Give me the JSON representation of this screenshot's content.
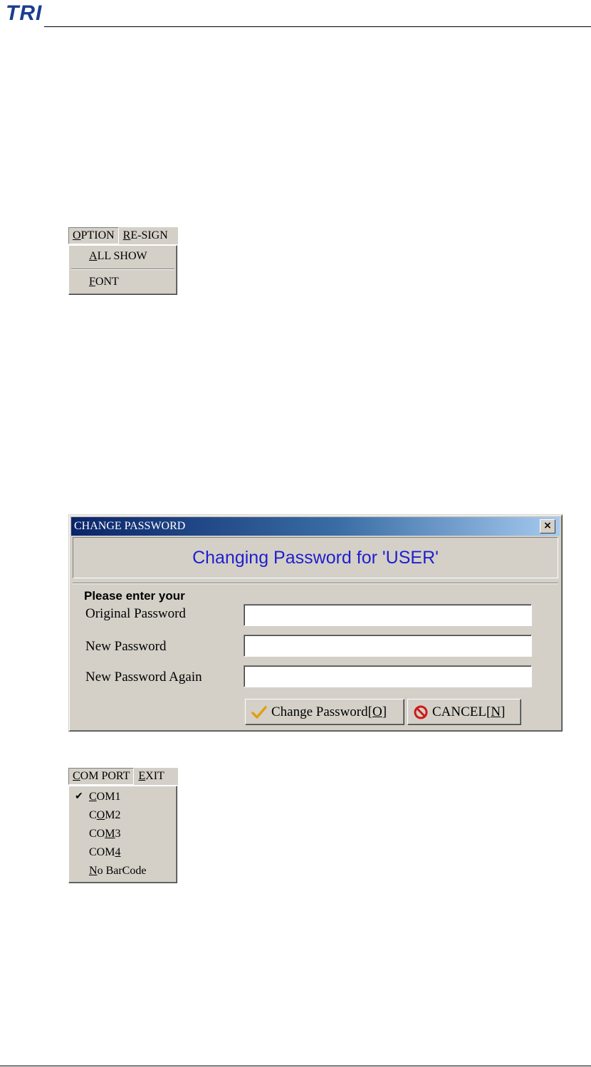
{
  "header": {
    "logo_text": "TRI"
  },
  "option_menu": {
    "menubar": [
      {
        "label_prefix": "",
        "mnemonic": "O",
        "label_rest": "PTION"
      },
      {
        "label_prefix": "",
        "mnemonic": "R",
        "label_rest": "E-SIGN"
      }
    ],
    "items": [
      {
        "mnemonic": "A",
        "label_rest": "LL SHOW"
      },
      {
        "mnemonic": "F",
        "label_rest": "ONT"
      }
    ]
  },
  "dialog": {
    "title": "CHANGE PASSWORD",
    "close_glyph": "×",
    "banner": "Changing Password for 'USER'",
    "prompt": "Please enter your",
    "fields": [
      {
        "label": "Original Password",
        "value": ""
      },
      {
        "label": "New Password",
        "value": ""
      },
      {
        "label": "New Password Again",
        "value": ""
      }
    ],
    "ok_button": {
      "label_prefix": "Change Password[",
      "mnemonic": "O",
      "label_suffix": "]",
      "icon": "checkmark-icon"
    },
    "cancel_button": {
      "label_prefix": "CANCEL[",
      "mnemonic": "N",
      "label_suffix": "]",
      "icon": "no-entry-icon"
    }
  },
  "com_menu": {
    "menubar": [
      {
        "label_prefix": "",
        "mnemonic": "C",
        "label_rest": "OM PORT"
      },
      {
        "label_prefix": "",
        "mnemonic": "E",
        "label_rest": "XIT"
      }
    ],
    "items": [
      {
        "pre": "",
        "mnemonic": "C",
        "post": "OM1",
        "checked": true,
        "check_glyph": "✔"
      },
      {
        "pre": "C",
        "mnemonic": "O",
        "post": "M2",
        "checked": false
      },
      {
        "pre": "CO",
        "mnemonic": "M",
        "post": "3",
        "checked": false
      },
      {
        "pre": "COM",
        "mnemonic": "4",
        "post": "",
        "checked": false
      },
      {
        "pre": "",
        "mnemonic": "N",
        "post": "o BarCode",
        "checked": false
      }
    ]
  }
}
